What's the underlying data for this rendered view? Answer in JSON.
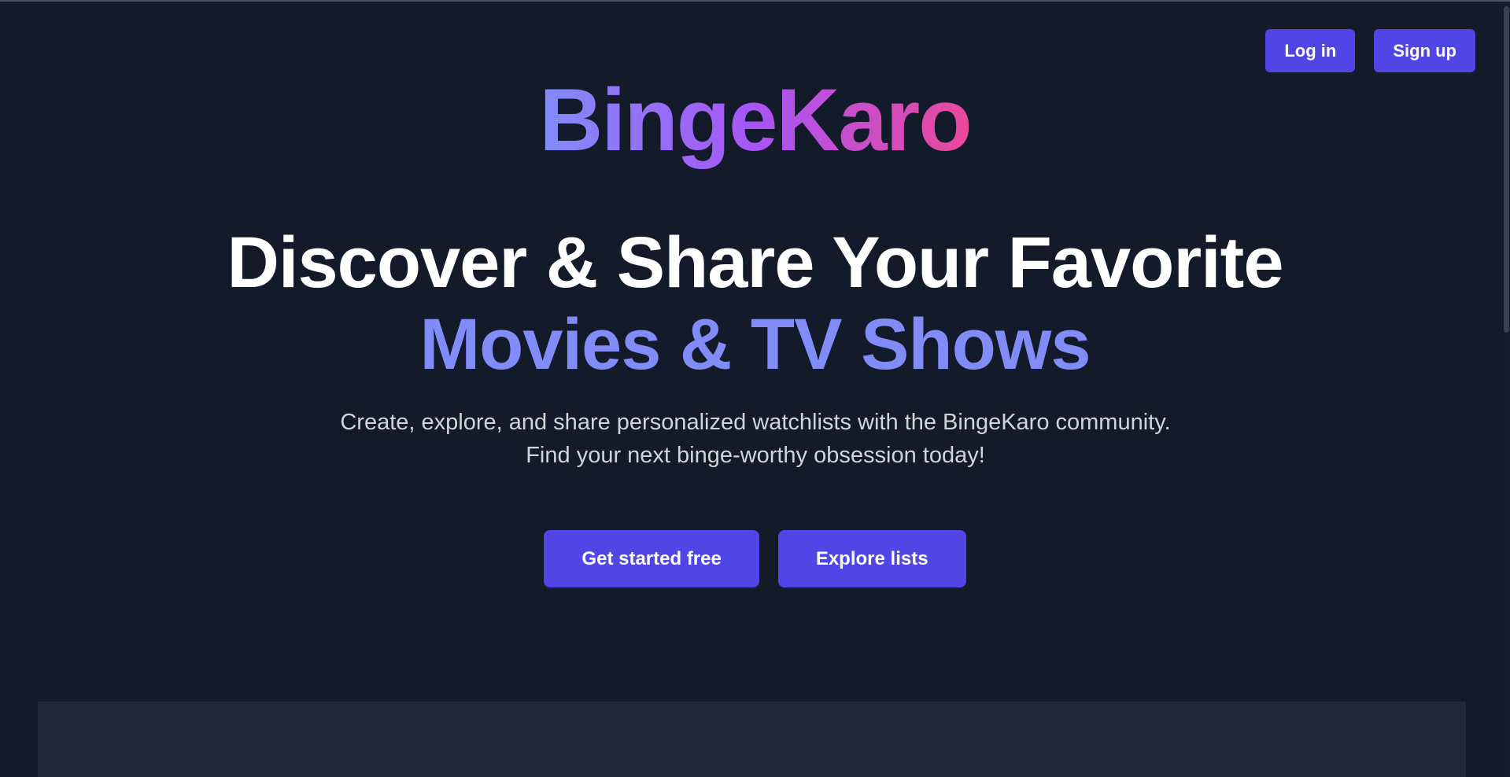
{
  "header": {
    "login_label": "Log in",
    "signup_label": "Sign up"
  },
  "hero": {
    "logo": "BingeKaro",
    "headline_line1": "Discover & Share Your Favorite",
    "headline_line2": "Movies & TV Shows",
    "subtitle": "Create, explore, and share personalized watchlists with the BingeKaro community. Find your next binge-worthy obsession today!",
    "cta_primary": "Get started free",
    "cta_secondary": "Explore lists"
  },
  "colors": {
    "background": "#131a2a",
    "accent": "#4f46e5",
    "headline_accent": "#818cf8",
    "panel": "#1f2937"
  }
}
